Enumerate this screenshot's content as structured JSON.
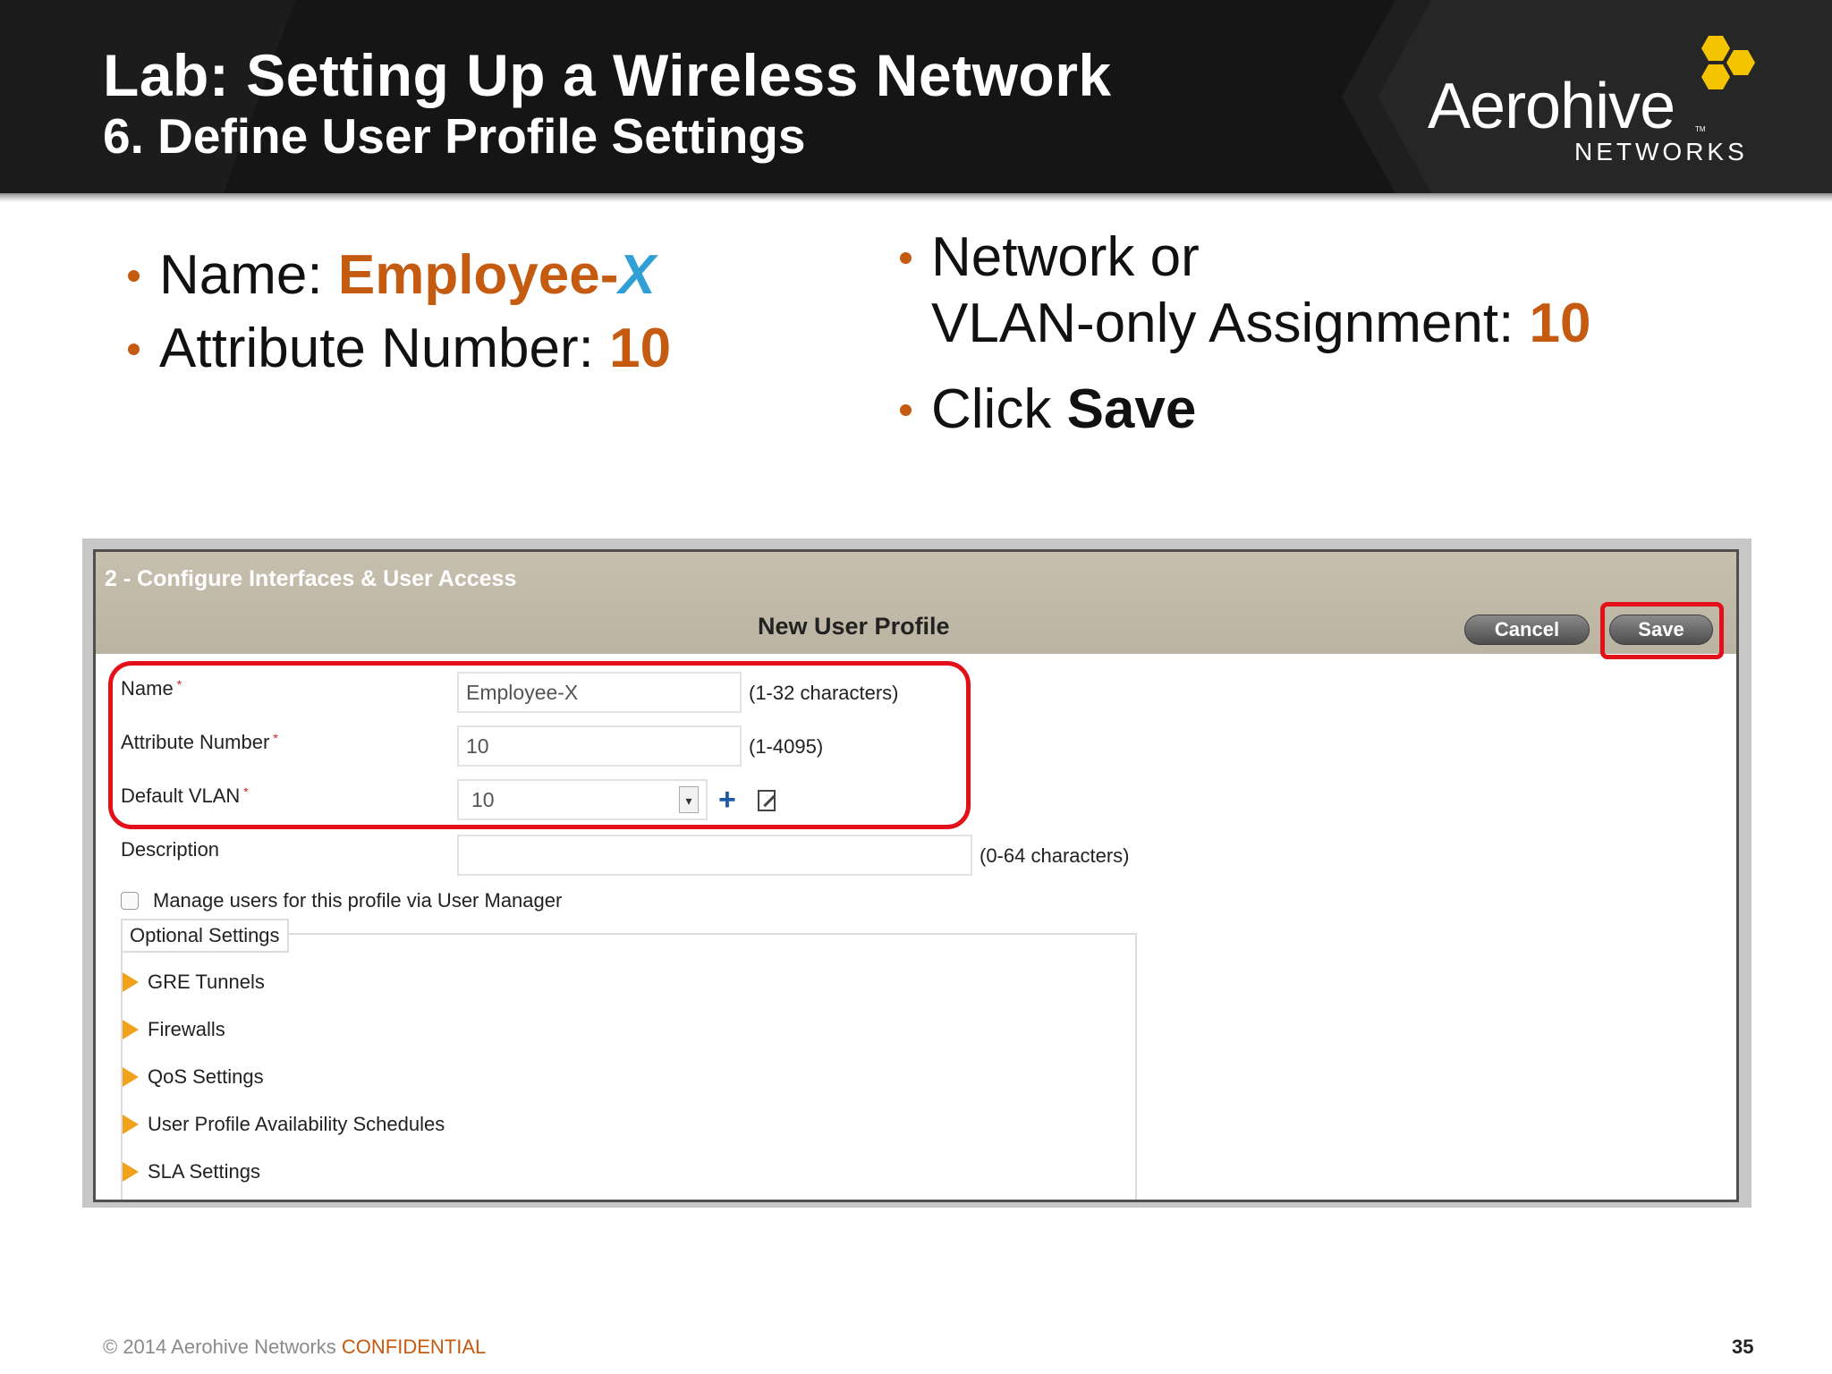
{
  "header": {
    "title": "Lab: Setting Up a Wireless Network",
    "subtitle": "6. Define User Profile Settings"
  },
  "logo": {
    "word": "Aerohive",
    "tm": "TM",
    "sub": "NETWORKS",
    "hex_color": "#f5c400"
  },
  "bullets": {
    "name_label": "Name: ",
    "name_value": "Employee-",
    "name_suffix": "X",
    "attr_label": "Attribute Number: ",
    "attr_value": "10",
    "vlan_line1": "Network or",
    "vlan_line2": "VLAN-only Assignment: ",
    "vlan_value": "10",
    "click_label": "Click ",
    "click_value": "Save"
  },
  "panel": {
    "wizard_step": "2 - Configure Interfaces & User Access",
    "form_title": "New User Profile",
    "cancel_label": "Cancel",
    "save_label": "Save",
    "fields": {
      "name_label": "Name",
      "name_value": "Employee-X",
      "name_hint": "(1-32 characters)",
      "attr_label": "Attribute Number",
      "attr_value": "10",
      "attr_hint": "(1-4095)",
      "vlan_label": "Default VLAN",
      "vlan_value": "10",
      "desc_label": "Description",
      "desc_value": "",
      "desc_hint": "(0-64 characters)",
      "required_mark": "*"
    },
    "manage_users_label": "Manage users for this profile via User Manager",
    "manage_users_checked": false,
    "optional_settings_legend": "Optional Settings",
    "optional_sections": [
      "GRE Tunnels",
      "Firewalls",
      "QoS Settings",
      "User Profile Availability Schedules",
      "SLA Settings"
    ]
  },
  "footer": {
    "copyright": "© 2014 Aerohive Networks ",
    "confidential": "CONFIDENTIAL",
    "page_number": "35"
  },
  "colors": {
    "accent_orange": "#c55a11",
    "accent_blue": "#2f9fd6",
    "highlight_red": "#e3101a",
    "header_bg": "#151515",
    "panel_header_bg": "#c6bfae"
  }
}
